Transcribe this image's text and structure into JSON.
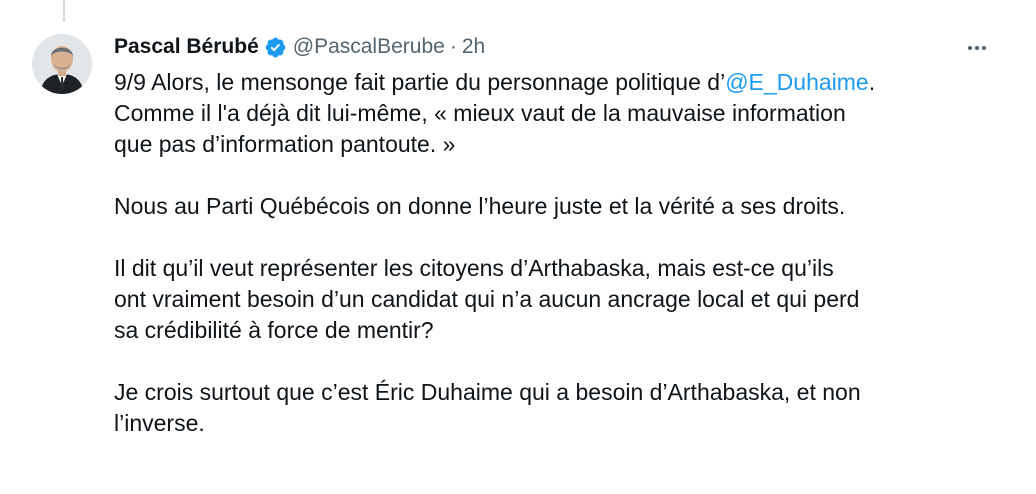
{
  "author": {
    "display_name": "Pascal Bérubé",
    "handle": "@PascalBerube",
    "separator": "·",
    "time": "2h",
    "verified_color": "#1d9bf0"
  },
  "icons": {
    "more": "more-horizontal-icon",
    "verified": "verified-badge-icon"
  },
  "tweet": {
    "p1_before": "9/9 Alors, le mensonge fait partie du personnage politique d’",
    "p1_mention": "@E_Duhaime",
    "p1_after_line1": ".",
    "p1_line2": "Comme il l'a déjà dit lui-même, « mieux vaut de la mauvaise information",
    "p1_line3": "que pas d’information pantoute. »",
    "p2": "Nous au Parti Québécois on donne l’heure juste et la vérité a ses droits.",
    "p3_line1": "Il dit qu’il veut représenter les citoyens d’Arthabaska, mais est-ce qu’ils",
    "p3_line2": "ont vraiment besoin d’un candidat qui n’a aucun ancrage local et qui perd",
    "p3_line3": "sa crédibilité à force de mentir?",
    "p4_line1": "Je crois surtout que c’est Éric Duhaime qui a besoin d’Arthabaska, et non",
    "p4_line2": "l’inverse."
  }
}
